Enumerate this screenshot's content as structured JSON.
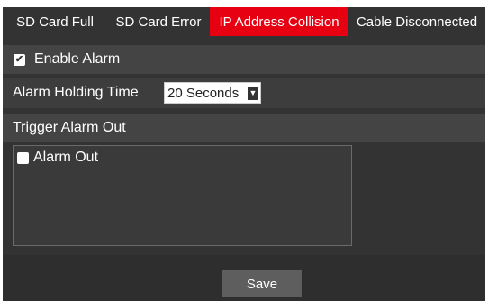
{
  "tabs": [
    {
      "label": "SD Card Full",
      "active": false
    },
    {
      "label": "SD Card Error",
      "active": false
    },
    {
      "label": "IP Address Collision",
      "active": true
    },
    {
      "label": "Cable Disconnected",
      "active": false
    }
  ],
  "enable_alarm": {
    "label": "Enable Alarm",
    "checked": true
  },
  "alarm_holding_time": {
    "label": "Alarm Holding Time",
    "selected": "20 Seconds"
  },
  "trigger_alarm_out": {
    "label": "Trigger Alarm Out"
  },
  "alarm_out": {
    "label": "Alarm Out",
    "checked": false
  },
  "footer": {
    "save_label": "Save"
  },
  "colors": {
    "active_tab": "#e60012",
    "panel_bg": "#333333",
    "button_bg": "#5e5e5e"
  }
}
